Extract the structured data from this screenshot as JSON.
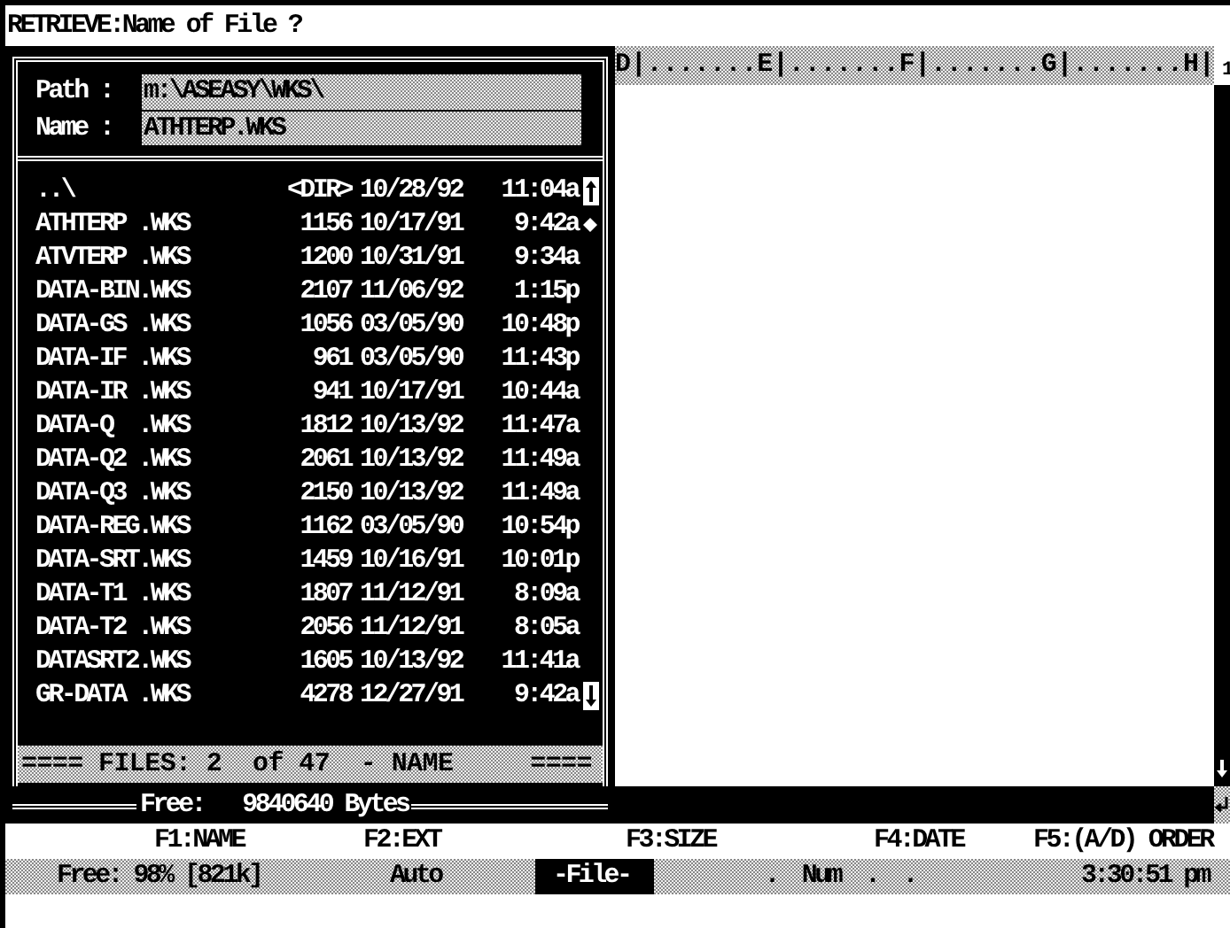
{
  "prompt": "RETRIEVE:Name of File ?",
  "dialog": {
    "path_label": "Path :",
    "path": "m:\\ASEASY\\WKS\\",
    "name_label": "Name :",
    "name": "ATHTERP.WKS",
    "files": [
      {
        "name": "..\\",
        "size": "<DIR>",
        "date": "10/28/92",
        "time": "11:04a"
      },
      {
        "name": "ATHTERP .WKS",
        "size": "1156",
        "date": "10/17/91",
        "time": "9:42a"
      },
      {
        "name": "ATVTERP .WKS",
        "size": "1200",
        "date": "10/31/91",
        "time": "9:34a"
      },
      {
        "name": "DATA-BIN.WKS",
        "size": "2107",
        "date": "11/06/92",
        "time": "1:15p"
      },
      {
        "name": "DATA-GS .WKS",
        "size": "1056",
        "date": "03/05/90",
        "time": "10:48p"
      },
      {
        "name": "DATA-IF .WKS",
        "size": "961",
        "date": "03/05/90",
        "time": "11:43p"
      },
      {
        "name": "DATA-IR .WKS",
        "size": "941",
        "date": "10/17/91",
        "time": "10:44a"
      },
      {
        "name": "DATA-Q  .WKS",
        "size": "1812",
        "date": "10/13/92",
        "time": "11:47a"
      },
      {
        "name": "DATA-Q2 .WKS",
        "size": "2061",
        "date": "10/13/92",
        "time": "11:49a"
      },
      {
        "name": "DATA-Q3 .WKS",
        "size": "2150",
        "date": "10/13/92",
        "time": "11:49a"
      },
      {
        "name": "DATA-REG.WKS",
        "size": "1162",
        "date": "03/05/90",
        "time": "10:54p"
      },
      {
        "name": "DATA-SRT.WKS",
        "size": "1459",
        "date": "10/16/91",
        "time": "10:01p"
      },
      {
        "name": "DATA-T1 .WKS",
        "size": "1807",
        "date": "11/12/91",
        "time": "8:09a"
      },
      {
        "name": "DATA-T2 .WKS",
        "size": "2056",
        "date": "11/12/91",
        "time": "8:05a"
      },
      {
        "name": "DATASRT2.WKS",
        "size": "1605",
        "date": "10/13/92",
        "time": "11:41a"
      },
      {
        "name": "GR-DATA .WKS",
        "size": "4278",
        "date": "12/27/91",
        "time": "9:42a"
      }
    ],
    "footer": "==== FILES: 2  of 47  - NAME     ====",
    "free": "Free:   9840640 Bytes"
  },
  "sheet": {
    "column_ruler": "D|.......E|.......F|.......G|.......H|",
    "row_number": "1"
  },
  "function_keys": [
    "F1:NAME",
    "F2:EXT",
    "F3:SIZE",
    "F4:DATE",
    "F5:(A/D) ORDER"
  ],
  "status_bar": {
    "memory": "Free: 98% [821k]",
    "mode": "Auto",
    "panel": "-File-",
    "indicators": [
      ".",
      "Num",
      ".",
      "."
    ],
    "clock": "3:30:51 pm"
  }
}
